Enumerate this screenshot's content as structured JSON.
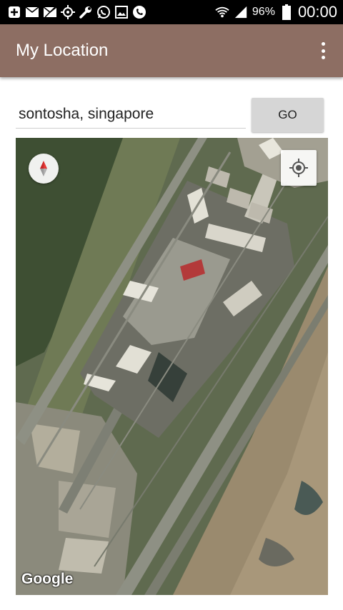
{
  "status_bar": {
    "icons": [
      "add-box-icon",
      "mail-icon",
      "mail-muted-icon",
      "gps-icon",
      "wrench-icon",
      "whatsapp-icon",
      "image-icon",
      "phone-icon"
    ],
    "battery": "96%",
    "time": "00:00"
  },
  "app_bar": {
    "title": "My Location",
    "background": "#8d6e63"
  },
  "search": {
    "value": "sontosha, singapore"
  },
  "go_button": {
    "label": "GO"
  },
  "map": {
    "attribution": "Google"
  }
}
